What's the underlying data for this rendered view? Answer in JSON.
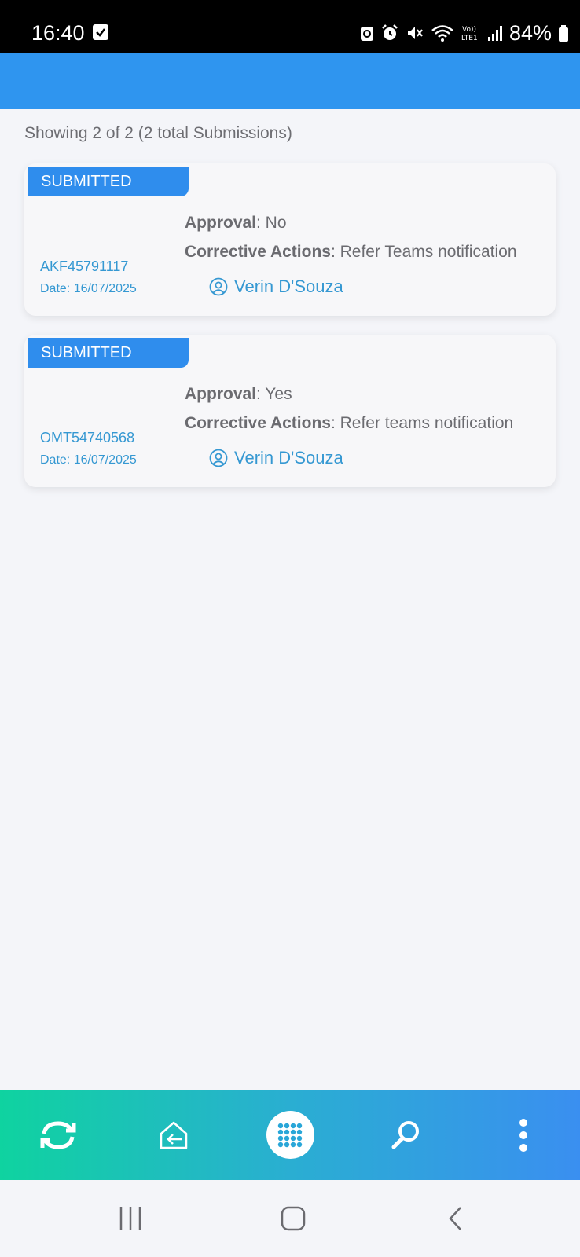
{
  "status_bar": {
    "time": "16:40",
    "battery": "84%"
  },
  "summary": "Showing 2 of 2 (2 total Submissions)",
  "submissions": [
    {
      "status": "SUBMITTED",
      "id": "AKF45791117",
      "date": "Date: 16/07/2025",
      "approval_label": "Approval",
      "approval_value": ": No",
      "actions_label": "Corrective Actions",
      "actions_value": ": Refer Teams notification",
      "user": "Verin D'Souza"
    },
    {
      "status": "SUBMITTED",
      "id": "OMT54740568",
      "date": "Date: 16/07/2025",
      "approval_label": "Approval",
      "approval_value": ": Yes",
      "actions_label": "Corrective Actions",
      "actions_value": ": Refer teams notification",
      "user": "Verin D'Souza"
    }
  ],
  "bottom_nav": {
    "items": [
      {
        "icon": "sync-icon"
      },
      {
        "icon": "exit-icon"
      },
      {
        "icon": "apps-grid-icon"
      },
      {
        "icon": "search-icon"
      },
      {
        "icon": "more-vertical-icon"
      }
    ]
  },
  "colors": {
    "header": "#2f95ef",
    "badge": "#2f8ded",
    "link": "#3598d2",
    "nav_gradient_start": "#0fd3a0",
    "nav_gradient_end": "#3a8ff0"
  }
}
